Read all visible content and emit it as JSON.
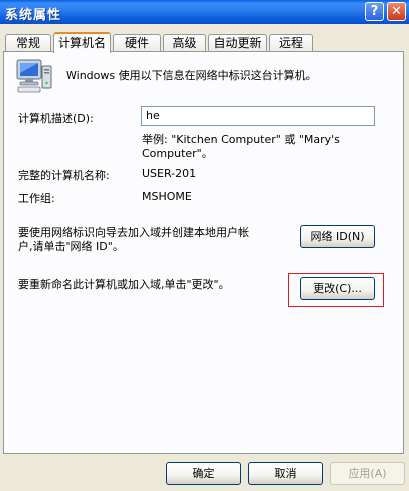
{
  "window": {
    "title": "系统属性",
    "help_button": "?",
    "close_button": "✕"
  },
  "tabs": [
    "常规",
    "计算机名",
    "硬件",
    "高级",
    "自动更新",
    "远程"
  ],
  "active_tab_index": 1,
  "content": {
    "intro": "Windows 使用以下信息在网络中标识这台计算机。",
    "description_label": "计算机描述(D):",
    "description_value": "he",
    "example_line1": "举例: \"Kitchen Computer\" 或 \"Mary's",
    "example_line2": "Computer\"。",
    "full_name_label": "完整的计算机名称:",
    "full_name_value": "USER-201",
    "workgroup_label": "工作组:",
    "workgroup_value": "MSHOME",
    "network_id_text_line1": "要使用网络标识向导去加入域并创建本地用户帐",
    "network_id_text_line2": "户,请单击\"网络 ID\"。",
    "network_id_button": "网络 ID(N)",
    "rename_text": "要重新命名此计算机或加入域,单击\"更改\"。",
    "change_button": "更改(C)..."
  },
  "footer": {
    "ok_button": "确定",
    "cancel_button": "取消",
    "apply_button": "应用(A)"
  },
  "colors": {
    "titlebar": "#0A5FE0",
    "highlight_border": "#E02020",
    "tab_accent": "#E68B2C"
  },
  "icons": {
    "computer": "computer-icon",
    "help": "help-icon",
    "close": "close-icon"
  }
}
